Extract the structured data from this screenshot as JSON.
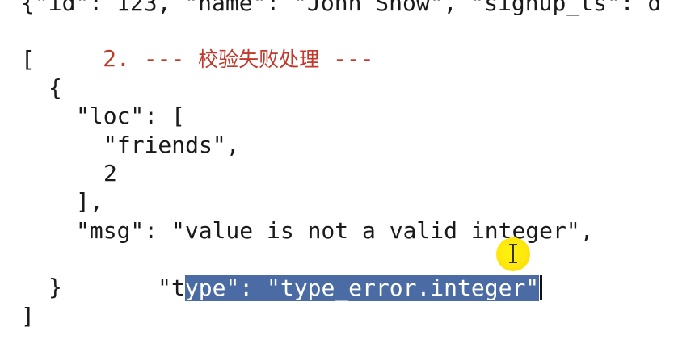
{
  "editor": {
    "lines": {
      "top": "{\"id\": 123, \"name\": \"John Snow\", \"signup_ts\": d",
      "heading_prefix": "2. --- ",
      "heading_zh": "校验失败处理",
      "heading_suffix": " ---",
      "open_bracket": "[",
      "open_brace": "{",
      "loc_line": "\"loc\": [",
      "friends_line": "\"friends\",",
      "index_line": "2",
      "close_loc": "],",
      "msg_line": "\"msg\": \"value is not a valid integer\",",
      "type_unselected": "\"t",
      "type_selected": "ype\": \"type_error.integer\"",
      "close_brace": "}",
      "close_bracket": "]"
    },
    "colors": {
      "heading": "#c0392b",
      "selection": "#4a6ba3",
      "cursor_highlight": "#ffe600"
    },
    "cursor_icon": "i-beam-cursor-icon"
  }
}
